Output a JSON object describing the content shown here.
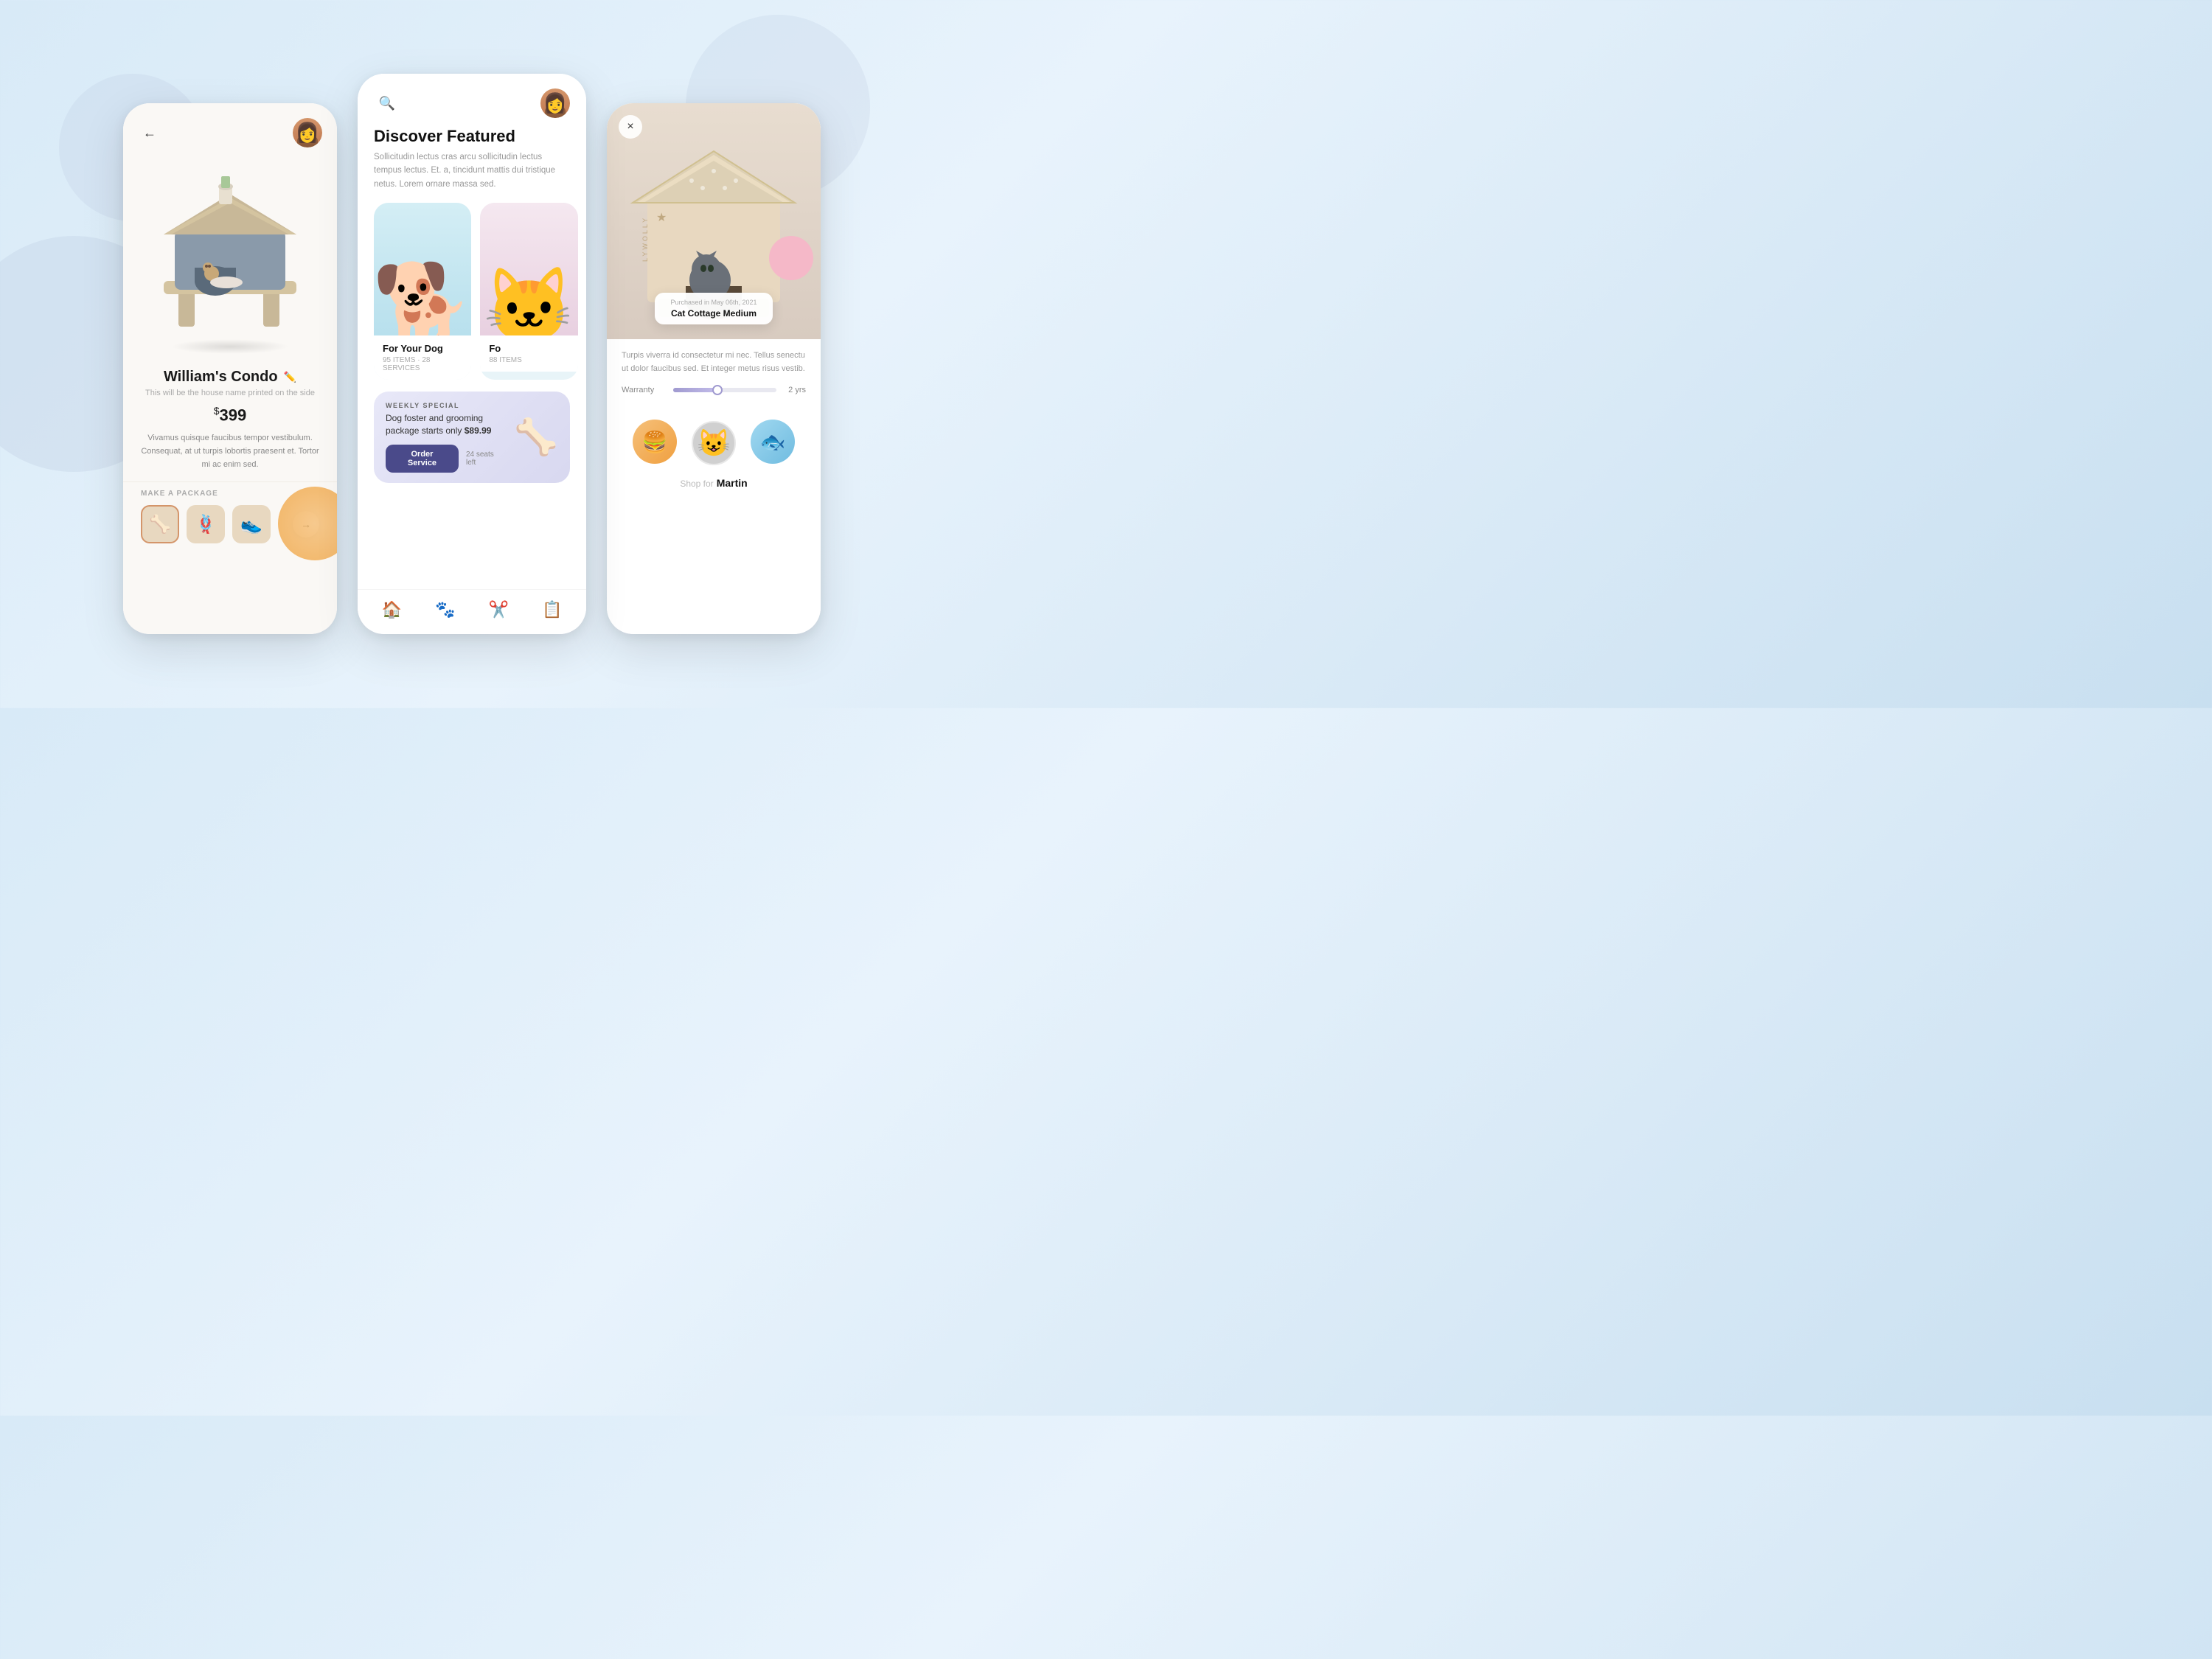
{
  "background": {
    "color": "#d8eaf7"
  },
  "left_phone": {
    "header": {
      "back_label": "←"
    },
    "product": {
      "name": "William's Condo",
      "subtitle": "This will be the house name printed on the side",
      "price": "$399",
      "price_symbol": "$",
      "price_amount": "399",
      "description": "Vivamus quisque faucibus tempor vestibulum. Consequat, at ut turpis lobortis praesent et. Tortor mi ac enim sed."
    },
    "package": {
      "label": "MAKE A PACKAGE",
      "items": [
        "🦴",
        "🪢",
        "👟"
      ]
    }
  },
  "center_phone": {
    "title": "Discover Featured",
    "subtitle": "Sollicitudin lectus cras arcu sollicitudin lectus tempus lectus. Et. a, tincidunt mattis dui tristique netus. Lorem ornare massa sed.",
    "cards": [
      {
        "title": "For Your Dog",
        "items": "95 ITEMS",
        "services": "28 SERVICES"
      },
      {
        "title": "Fo",
        "items": "88 ITEMS"
      }
    ],
    "weekly_special": {
      "label": "WEEKLY SPECIAL",
      "description": "Dog foster and grooming package starts only $89.99",
      "price": "$89.99",
      "cta": "Order Service",
      "seats": "24 seats left"
    },
    "nav": {
      "items": [
        "🏠",
        "🐾",
        "✂️",
        "📋"
      ]
    }
  },
  "right_phone": {
    "close_label": "×",
    "purchase": {
      "date": "Purchased in May 06th, 2021",
      "name": "Cat Cottage Medium"
    },
    "description": "Turpis viverra id consectetur mi nec. Tellus senectu ut dolor faucibus sed. Et integer metus risus vestib.",
    "warranty": {
      "label": "Warranty",
      "value": "2 yrs",
      "fill_percent": 40
    },
    "shop": {
      "label": "Shop for",
      "name": "Martin",
      "icons": [
        "🍔",
        "😺",
        "🐟"
      ]
    }
  }
}
